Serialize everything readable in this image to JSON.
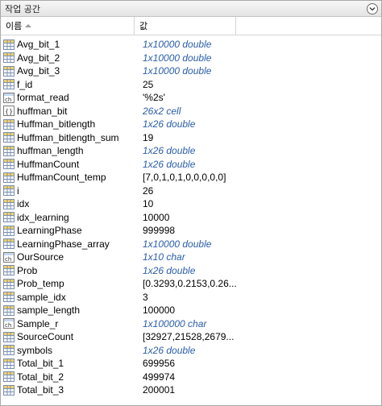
{
  "panel": {
    "title": "작업 공간"
  },
  "header": {
    "col_name": "이름",
    "col_value": "값",
    "col_extra": ""
  },
  "rows": [
    {
      "name": "Avg_bit_1",
      "value": "1x10000 double",
      "icon": "matrix-icon",
      "italic": true
    },
    {
      "name": "Avg_bit_2",
      "value": "1x10000 double",
      "icon": "matrix-icon",
      "italic": true
    },
    {
      "name": "Avg_bit_3",
      "value": "1x10000 double",
      "icon": "matrix-icon",
      "italic": true
    },
    {
      "name": "f_id",
      "value": "25",
      "icon": "matrix-icon",
      "italic": false
    },
    {
      "name": "format_read",
      "value": "'%2s'",
      "icon": "char-icon",
      "italic": false
    },
    {
      "name": "huffman_bit",
      "value": "26x2 cell",
      "icon": "cell-icon",
      "italic": true
    },
    {
      "name": "Huffman_bitlength",
      "value": "1x26 double",
      "icon": "matrix-icon",
      "italic": true
    },
    {
      "name": "Huffman_bitlength_sum",
      "value": "19",
      "icon": "matrix-icon",
      "italic": false
    },
    {
      "name": "huffman_length",
      "value": "1x26 double",
      "icon": "matrix-icon",
      "italic": true
    },
    {
      "name": "HuffmanCount",
      "value": "1x26 double",
      "icon": "matrix-icon",
      "italic": true
    },
    {
      "name": "HuffmanCount_temp",
      "value": "[7,0,1,0,1,0,0,0,0,0]",
      "icon": "matrix-icon",
      "italic": false
    },
    {
      "name": "i",
      "value": "26",
      "icon": "matrix-icon",
      "italic": false
    },
    {
      "name": "idx",
      "value": "10",
      "icon": "matrix-icon",
      "italic": false
    },
    {
      "name": "idx_learning",
      "value": "10000",
      "icon": "matrix-icon",
      "italic": false
    },
    {
      "name": "LearningPhase",
      "value": "999998",
      "icon": "matrix-icon",
      "italic": false
    },
    {
      "name": "LearningPhase_array",
      "value": "1x10000 double",
      "icon": "matrix-icon",
      "italic": true
    },
    {
      "name": "OurSource",
      "value": "1x10 char",
      "icon": "char-icon",
      "italic": true
    },
    {
      "name": "Prob",
      "value": "1x26 double",
      "icon": "matrix-icon",
      "italic": true
    },
    {
      "name": "Prob_temp",
      "value": "[0.3293,0.2153,0.26...",
      "icon": "matrix-icon",
      "italic": false
    },
    {
      "name": "sample_idx",
      "value": "3",
      "icon": "matrix-icon",
      "italic": false
    },
    {
      "name": "sample_length",
      "value": "100000",
      "icon": "matrix-icon",
      "italic": false
    },
    {
      "name": "Sample_r",
      "value": "1x100000 char",
      "icon": "char-icon",
      "italic": true
    },
    {
      "name": "SourceCount",
      "value": "[32927,21528,2679...",
      "icon": "matrix-icon",
      "italic": false
    },
    {
      "name": "symbols",
      "value": "1x26 double",
      "icon": "matrix-icon",
      "italic": true
    },
    {
      "name": "Total_bit_1",
      "value": "699956",
      "icon": "matrix-icon",
      "italic": false
    },
    {
      "name": "Total_bit_2",
      "value": "499974",
      "icon": "matrix-icon",
      "italic": false
    },
    {
      "name": "Total_bit_3",
      "value": "200001",
      "icon": "matrix-icon",
      "italic": false
    }
  ]
}
